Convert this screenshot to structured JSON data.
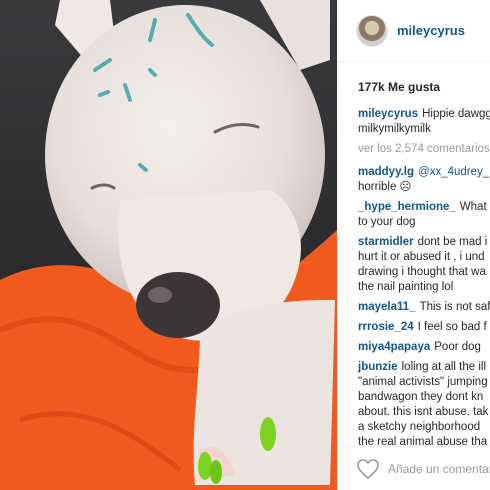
{
  "colors": {
    "link": "#125688",
    "text": "#262626",
    "muted": "#999999",
    "orange_blanket": "#f05a1e",
    "green_nails": "#7ed321"
  },
  "post": {
    "username": "mileycyrus",
    "likes": "177k Me gusta",
    "view_more": "ver los 2,574 comentarios",
    "add_comment_placeholder": "Añade un comentario...",
    "comments": [
      {
        "user": "mileycyrus",
        "text": "Hippie dawgg",
        "lines": [
          "milkymilkymilk"
        ]
      },
      {
        "user": "maddyy.lg",
        "mention": "@xx_4udrey_",
        "text": "",
        "lines": [
          "horrible ☹"
        ]
      },
      {
        "user": "_hype_hermione_",
        "text": "What",
        "lines": [
          "to your dog"
        ]
      },
      {
        "user": "starmidler",
        "text": "dont be mad i",
        "lines": [
          "hurt it or abused it , i und",
          "drawing i thought that wa",
          "the nail painting lol"
        ]
      },
      {
        "user": "mayela11_",
        "text": "This is not saf",
        "lines": []
      },
      {
        "user": "rrrosie_24",
        "text": "I feel so bad f",
        "lines": []
      },
      {
        "user": "miya4papaya",
        "text": "Poor dog",
        "lines": []
      },
      {
        "user": "jbunzie",
        "text": "loling at all the ill",
        "lines": [
          "\"animal activists\" jumping",
          "bandwagon they dont kn",
          "about. this isnt abuse. tak",
          "a sketchy neighborhood",
          "the real animal abuse tha"
        ]
      }
    ]
  },
  "icons": {
    "heart": "heart-outline-icon"
  }
}
